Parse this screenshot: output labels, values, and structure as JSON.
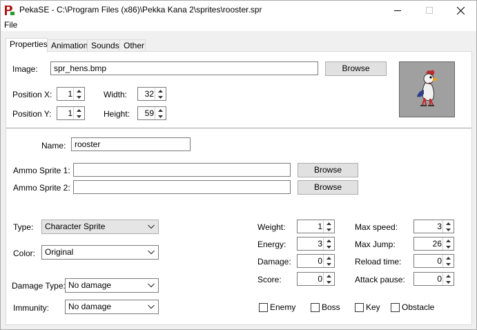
{
  "window": {
    "title": "PekaSE - C:\\Program Files (x86)\\Pekka Kana 2\\sprites\\rooster.spr",
    "icon": "pekase-app-icon",
    "controls": [
      "minimize-icon",
      "maximize-icon",
      "close-icon"
    ]
  },
  "menu": {
    "file": "File"
  },
  "tabs": [
    {
      "label": "Properties",
      "active": true
    },
    {
      "label": "Animation",
      "active": false
    },
    {
      "label": "Sounds",
      "active": false
    },
    {
      "label": "Other",
      "active": false
    }
  ],
  "image": {
    "label": "Image:",
    "value": "spr_hens.bmp",
    "browse": "Browse"
  },
  "position_x": {
    "label": "Position X:",
    "value": "1"
  },
  "position_y": {
    "label": "Position Y:",
    "value": "1"
  },
  "width": {
    "label": "Width:",
    "value": "32"
  },
  "height": {
    "label": "Height:",
    "value": "59"
  },
  "name": {
    "label": "Name:",
    "value": "rooster"
  },
  "ammo1": {
    "label": "Ammo Sprite 1:",
    "value": "",
    "browse": "Browse"
  },
  "ammo2": {
    "label": "Ammo Sprite 2:",
    "value": "",
    "browse": "Browse"
  },
  "type": {
    "label": "Type:",
    "value": "Character Sprite"
  },
  "color": {
    "label": "Color:",
    "value": "Original"
  },
  "damage_type": {
    "label": "Damage Type:",
    "value": "No damage"
  },
  "immunity": {
    "label": "Immunity:",
    "value": "No damage"
  },
  "weight": {
    "label": "Weight:",
    "value": "1"
  },
  "energy": {
    "label": "Energy:",
    "value": "3"
  },
  "damage": {
    "label": "Damage:",
    "value": "0"
  },
  "score": {
    "label": "Score:",
    "value": "0"
  },
  "max_speed": {
    "label": "Max speed:",
    "value": "3"
  },
  "max_jump": {
    "label": "Max Jump:",
    "value": "26"
  },
  "reload_time": {
    "label": "Reload time:",
    "value": "0"
  },
  "attack_pause": {
    "label": "Attack pause:",
    "value": "0"
  },
  "checkboxes": {
    "enemy": {
      "label": "Enemy",
      "checked": false
    },
    "boss": {
      "label": "Boss",
      "checked": false
    },
    "key": {
      "label": "Key",
      "checked": false
    },
    "obstacle": {
      "label": "Obstacle",
      "checked": false
    }
  },
  "colors": {
    "panel_bg": "#ffffff",
    "window_bg": "#f0f0f0",
    "preview_bg": "#a0a0a0"
  }
}
